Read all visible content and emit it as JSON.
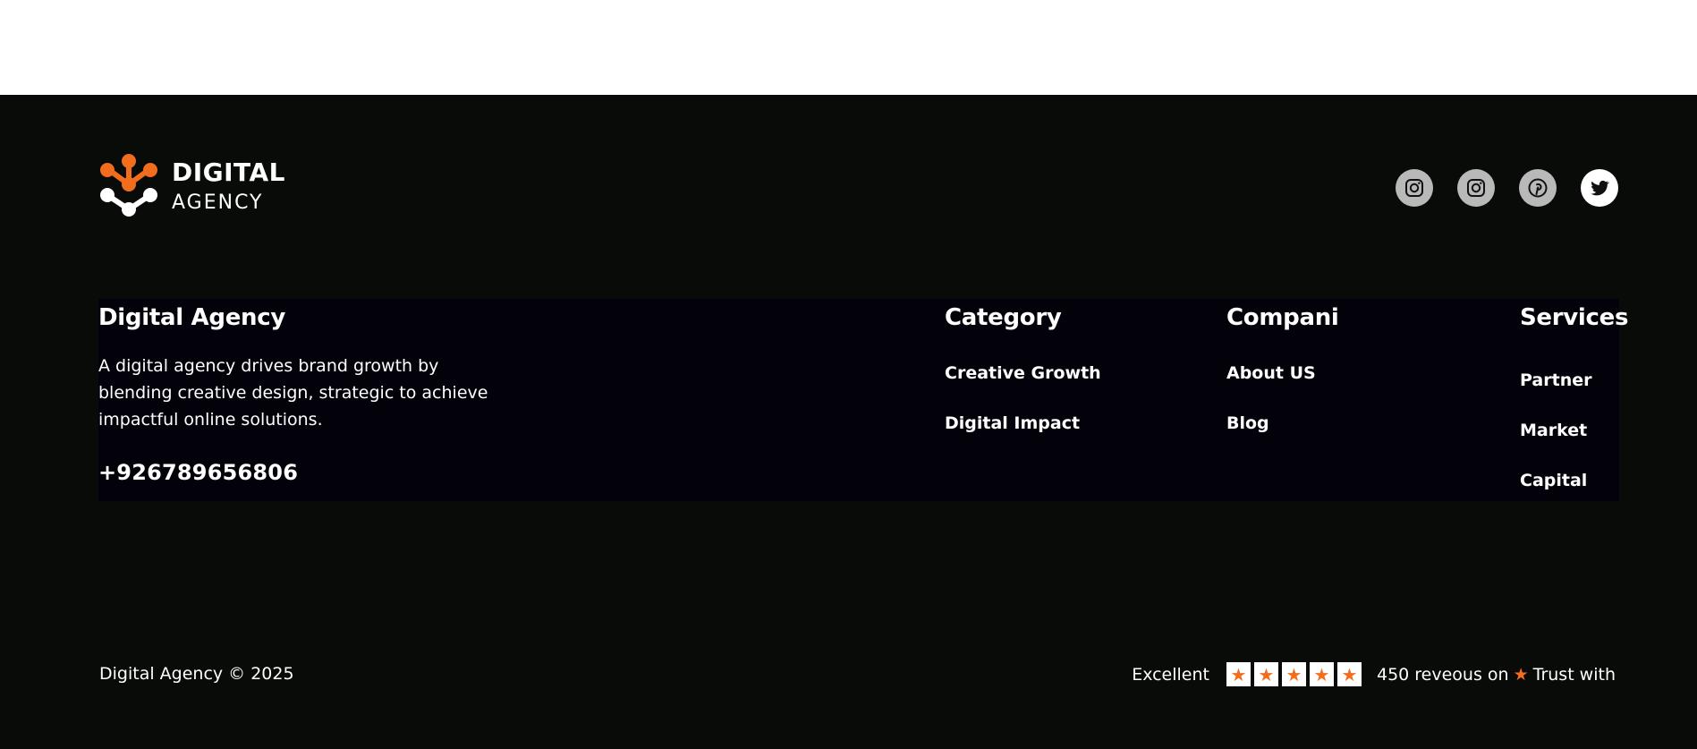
{
  "brand": {
    "line1": "DIGITAL",
    "line2": "AGENCY",
    "accent_color": "#f26e1c"
  },
  "socials": [
    {
      "icon": "instagram-icon"
    },
    {
      "icon": "instagram-icon"
    },
    {
      "icon": "pinterest-icon"
    },
    {
      "icon": "twitter-icon"
    }
  ],
  "about": {
    "title": "Digital Agency",
    "description": "A digital agency drives brand growth by blending creative design, strategic  to achieve impactful online solutions.",
    "phone": "+926789656806"
  },
  "category": {
    "title": "Category",
    "links": [
      "Creative Growth",
      "Digital Impact"
    ]
  },
  "company": {
    "title": "Compani",
    "links": [
      "About US",
      "Blog"
    ]
  },
  "services": {
    "title": "Services",
    "links": [
      "Partner",
      "Market",
      "Capital"
    ]
  },
  "bottom": {
    "copyright": "Digital Agency © 2025",
    "rating_label": "Excellent",
    "stars": 5,
    "reviews_text": "450 reveous on",
    "trust_text": "Trust with"
  }
}
